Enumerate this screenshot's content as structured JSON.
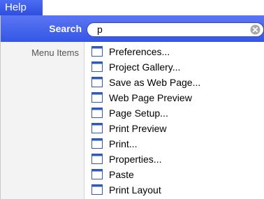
{
  "menubar": {
    "help_label": "Help"
  },
  "search": {
    "label": "Search",
    "value": "p"
  },
  "sidebar": {
    "menu_items_label": "Menu Items"
  },
  "results": [
    {
      "label": "Preferences..."
    },
    {
      "label": "Project Gallery..."
    },
    {
      "label": "Save as Web Page..."
    },
    {
      "label": "Web Page Preview"
    },
    {
      "label": "Page Setup..."
    },
    {
      "label": "Print Preview"
    },
    {
      "label": "Print..."
    },
    {
      "label": "Properties..."
    },
    {
      "label": "Paste"
    },
    {
      "label": "Print Layout"
    }
  ],
  "colors": {
    "accent": "#3556e6",
    "icon": "#2f59b8"
  },
  "icons": {
    "result_icon": "menu-item-icon",
    "clear": "clear-search-icon"
  }
}
